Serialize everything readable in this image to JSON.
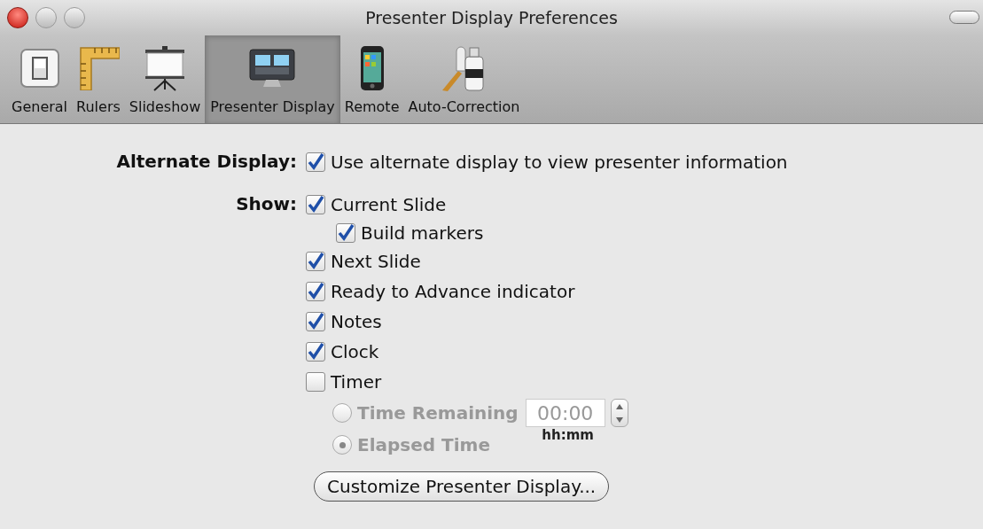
{
  "window": {
    "title": "Presenter Display Preferences"
  },
  "toolbar": [
    {
      "label": "General",
      "kind": "general",
      "selected": false
    },
    {
      "label": "Rulers",
      "kind": "rulers",
      "selected": false
    },
    {
      "label": "Slideshow",
      "kind": "slideshow",
      "selected": false
    },
    {
      "label": "Presenter Display",
      "kind": "display",
      "selected": true
    },
    {
      "label": "Remote",
      "kind": "remote",
      "selected": false
    },
    {
      "label": "Auto-Correction",
      "kind": "correction",
      "selected": false
    }
  ],
  "sections": [
    {
      "label": "Alternate Display:",
      "options": [
        {
          "label": "Use alternate display to view presenter information",
          "checked": true
        }
      ]
    },
    {
      "label": "Show:",
      "options": [
        {
          "label": "Current Slide",
          "checked": true,
          "children": [
            {
              "label": "Build markers",
              "checked": true
            }
          ]
        },
        {
          "label": "Next Slide",
          "checked": true
        },
        {
          "label": "Ready to Advance indicator",
          "checked": true
        },
        {
          "label": "Notes",
          "checked": true
        },
        {
          "label": "Clock",
          "checked": true
        },
        {
          "label": "Timer",
          "checked": false
        }
      ]
    }
  ],
  "timer": {
    "disabled": true,
    "modes": [
      {
        "label": "Time Remaining",
        "selected": false
      },
      {
        "label": "Elapsed Time",
        "selected": true
      }
    ],
    "time_value": "00:00",
    "time_format": "hh:mm"
  },
  "customize_button": "Customize Presenter Display..."
}
